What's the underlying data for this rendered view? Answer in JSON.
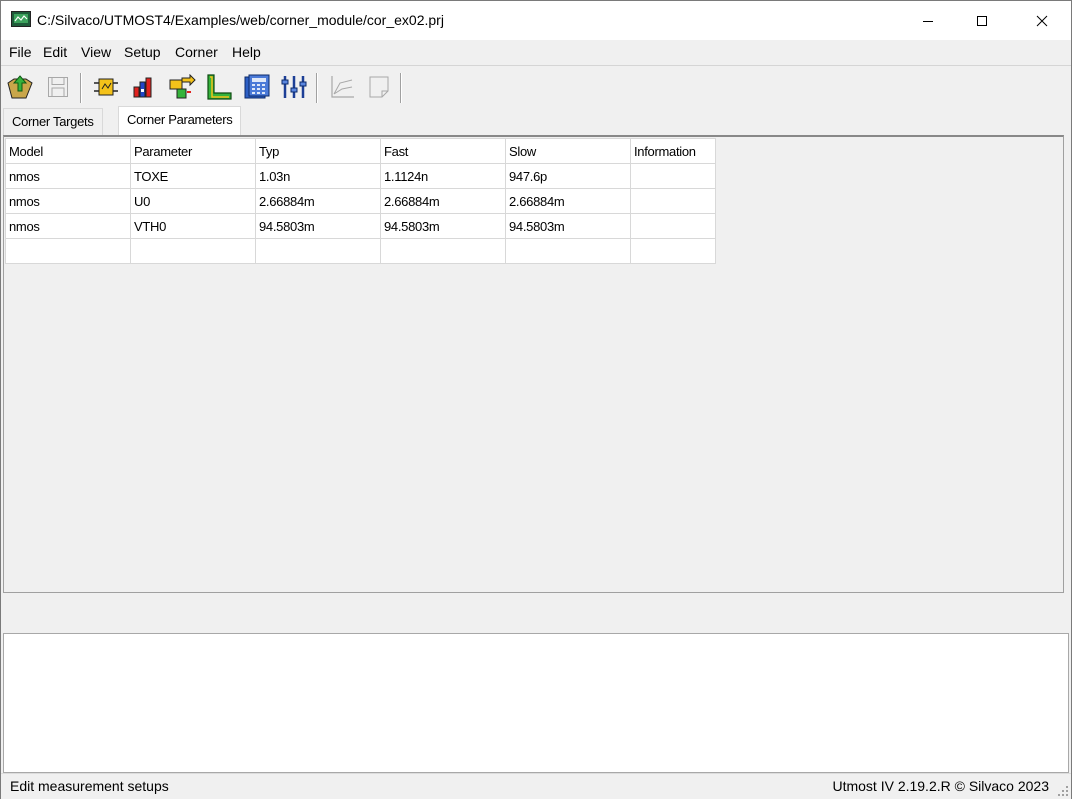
{
  "window": {
    "title": "C:/Silvaco/UTMOST4/Examples/web/corner_module/cor_ex02.prj"
  },
  "menu": [
    "File",
    "Edit",
    "View",
    "Setup",
    "Corner",
    "Help"
  ],
  "toolbar": {
    "icons": [
      "open-project-icon",
      "save-icon",
      "module-icon",
      "chart-icon",
      "transfer-icon",
      "setup-icon",
      "calculator-icon",
      "sliders-icon",
      "plot-icon",
      "page-icon"
    ]
  },
  "tabs": [
    {
      "label": "Corner Targets",
      "active": false
    },
    {
      "label": "Corner Parameters",
      "active": true
    }
  ],
  "table": {
    "headers": [
      "Model",
      "Parameter",
      "Typ",
      "Fast",
      "Slow",
      "Information"
    ],
    "rows": [
      [
        "nmos",
        "TOXE",
        "1.03n",
        "1.1124n",
        "947.6p",
        ""
      ],
      [
        "nmos",
        "U0",
        "2.66884m",
        "2.66884m",
        "2.66884m",
        ""
      ],
      [
        "nmos",
        "VTH0",
        "94.5803m",
        "94.5803m",
        "94.5803m",
        ""
      ],
      [
        "",
        "",
        "",
        "",
        "",
        ""
      ]
    ]
  },
  "status": {
    "left": "Edit measurement setups",
    "right": "Utmost IV 2.19.2.R © Silvaco 2023"
  }
}
